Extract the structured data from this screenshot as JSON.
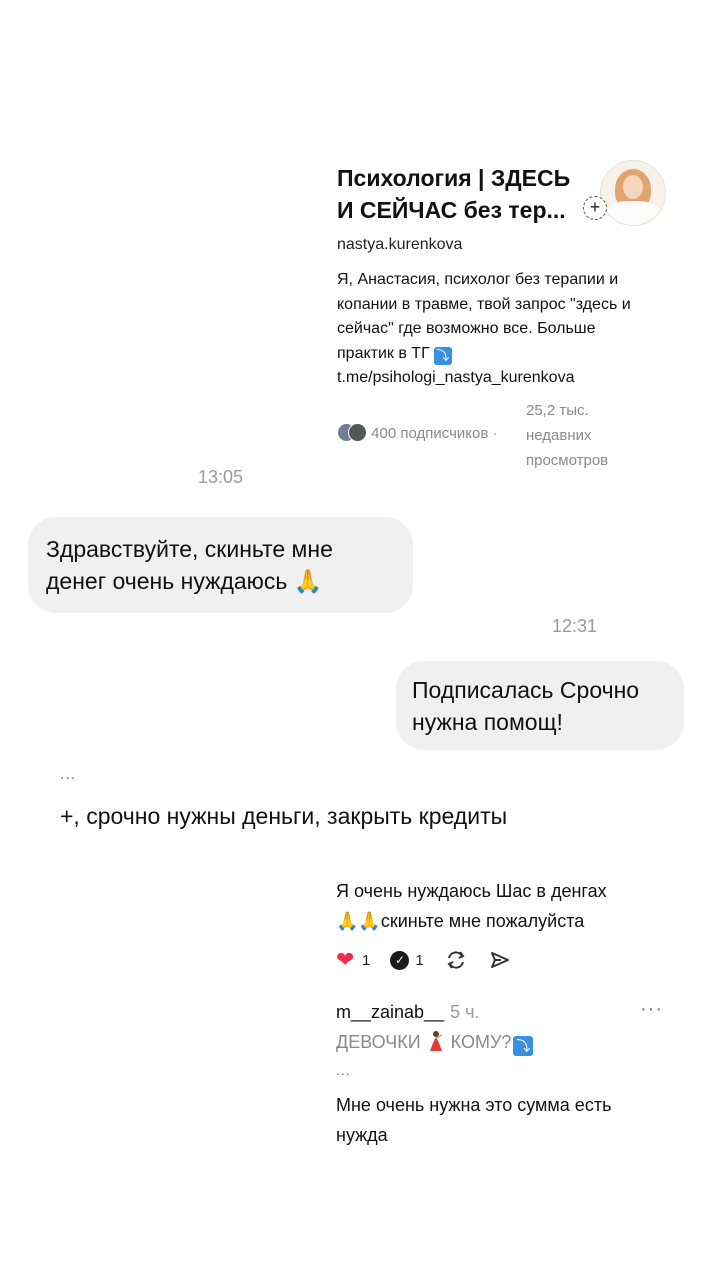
{
  "profile": {
    "title_line1": "Психология | ЗДЕСЬ",
    "title_line2": "И СЕЙЧАС без тер...",
    "follow_symbol": "+",
    "handle": "nastya.kurenkova",
    "bio_lines": [
      "Я, Анастасия, психолог без терапии и",
      "копании в травме, твой запрос \"здесь и",
      "сейчас\" где возможно все. Больше",
      "практик в ТГ",
      "t.me/psihologi_nastya_kurenkova"
    ],
    "tg_arrow": "⤵",
    "subscribers": "400 подписчиков",
    "separator": "·",
    "views_lines": [
      "25,2 тыс.",
      "недавних",
      "просмотров"
    ]
  },
  "chat": {
    "time_1": "13:05",
    "message_in": [
      "Здравствуйте, скиньте мне",
      "денег очень нуждаюсь 🙏"
    ],
    "time_2": "12:31",
    "message_out": [
      "Подписалась Срочно",
      "нужна помощ!"
    ]
  },
  "comments": {
    "ellipsis_1": "...",
    "comment_main": "+, срочно нужны деньги, закрыть кредиты",
    "reply_text": [
      "Я очень нуждаюсь Шас в денгах",
      "🙏🙏скиньте мне пожалуйста"
    ],
    "likes": "1",
    "replies": "1",
    "reply_user": "m__zainab__",
    "reply_time": "5 ч.",
    "more": "···",
    "quote_start": "ДЕВОЧКИ",
    "quote_end": "КОМУ?",
    "quote_arrow": "⤵",
    "ellipsis_2": "...",
    "final_text": [
      "Мне очень нужна это сумма есть",
      "нужда"
    ]
  },
  "colors": {
    "bubble_bg": "#f0f0f0",
    "heart": "#ee2e4a",
    "muted": "#8a8a8a",
    "tg_blue": "#3b8fe0"
  }
}
